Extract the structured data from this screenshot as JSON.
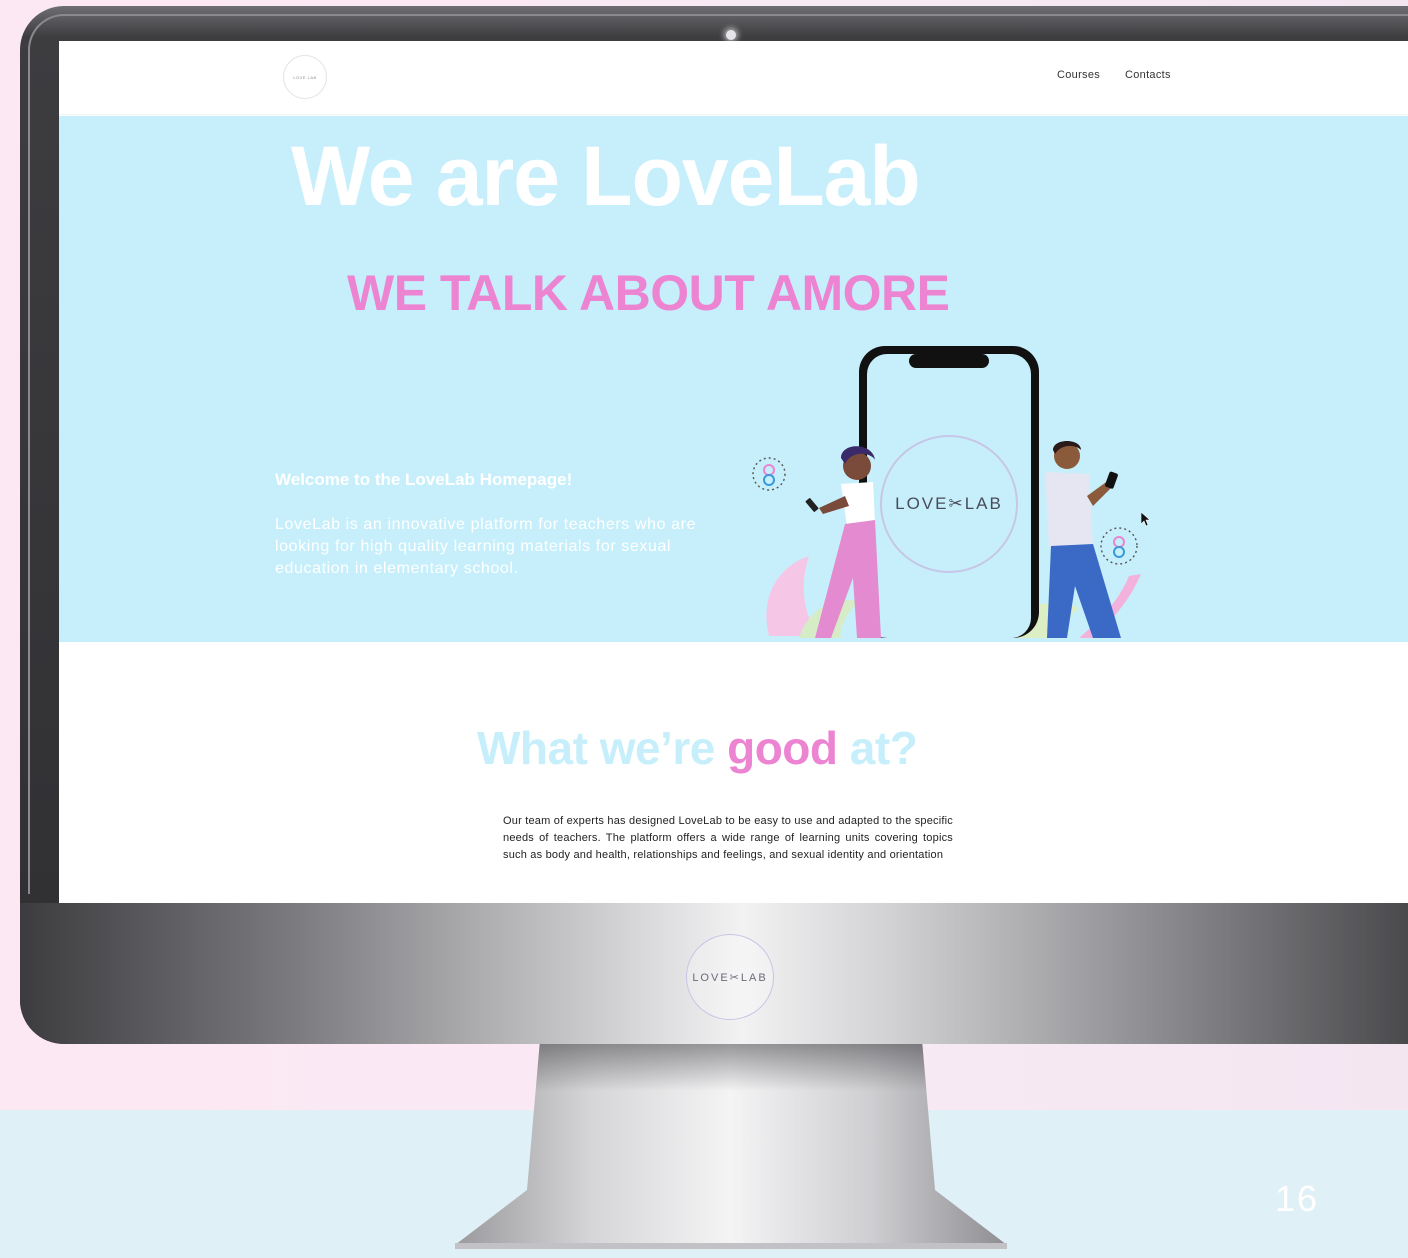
{
  "slide": {
    "number": "16"
  },
  "nav": {
    "logo_text": "LOVE LAB",
    "links": [
      "Courses",
      "Contacts"
    ]
  },
  "hero": {
    "title": "We are LoveLab",
    "subtitle": "WE TALK ABOUT AMORE",
    "welcome": "Welcome to the LoveLab Homepage!",
    "intro": "LoveLab is an innovative platform for teachers who are looking for high quality learning materials for sexual education in elementary school.",
    "phone_logo": "LOVE✂LAB"
  },
  "section2": {
    "title_part1": "What we’re ",
    "title_part2": "good",
    "title_part3": " at?",
    "text": "Our team of experts has designed LoveLab to be easy to use and adapted to the specific needs of teachers. The platform offers a wide range of learning units covering topics such as body and health, relationships and feelings, and sexual identity and orientation"
  },
  "monitor": {
    "chin_logo": "LOVE✂LAB"
  },
  "colors": {
    "hero_bg": "#c6effb",
    "pink": "#ec84d2",
    "white": "#ffffff"
  }
}
